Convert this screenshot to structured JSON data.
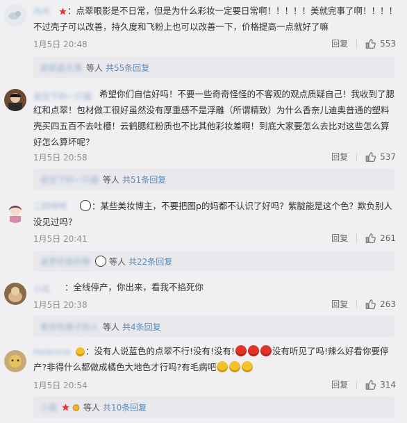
{
  "comments": [
    {
      "name": "丹丹",
      "text": "：点翠眼影是不日常，但是为什么彩妆一定要日常啊！！！！！美就完事了啊！！！！不过壳子可以改善，持久度和飞粉上也可以改善一下，价格提高一点就好了嘛",
      "time": "1月5日 20:48",
      "reply_label": "回复",
      "likes": "553",
      "thread_name": "庭前晶光落",
      "thread_mid": "等人",
      "thread_count": "共55条回复"
    },
    {
      "name": "是空下的一只猫",
      "text": "希望你们自信好吗！不要一些奇奇怪怪的不客观的观点质疑自己！我收到了腮红和点翠！包材做工很好虽然没有厚重感不是浮雕（所谓精致）为什么香奈儿迪奥普通的塑料壳买四五百不去吐槽！云鹤腮红粉质也不比其他彩妆差啊！到底大家要怎么去比对这些怎么算好怎么算坏呢？",
      "time": "1月5日 20:58",
      "reply_label": "回复",
      "likes": "537",
      "thread_name": "是空下的一只猫",
      "thread_mid": "等人",
      "thread_count": "共51条回复"
    },
    {
      "name": "二四呀呀",
      "text": "：某些美妆博主，不要把图p的妈都不认识了好吗？紫靛能是这个色？欺负别人没见过吗？",
      "time": "1月5日 20:41",
      "reply_label": "回复",
      "likes": "261",
      "thread_name": "波罗吃饭的熊",
      "thread_mid": "等人",
      "thread_count": "共22条回复"
    },
    {
      "name": "小瓜",
      "text": "：全线停产，你出来，看我不掐死你",
      "time": "1月5日 20:38",
      "reply_label": "回复",
      "likes": "263",
      "thread_name": "喜欢吃橘子的人",
      "thread_mid": "等人",
      "thread_count": "共4条回复"
    },
    {
      "name": "HeiAnnie",
      "text_a": "：没有人说蓝色的点翠不行!没有!没有!",
      "text_b": "没有听见了吗!辣么好看你要停产?非得什么都做成橘色大地色才行吗?有毛病吧",
      "time": "1月5日 20:54",
      "reply_label": "回复",
      "likes": "314",
      "thread_name": "小茵",
      "thread_mid": "等人",
      "thread_count": "共10条回复"
    }
  ],
  "colors": {
    "link": "#5a89b8",
    "bg": "#f0f0f3",
    "reply_bg": "#e8e8ed"
  }
}
